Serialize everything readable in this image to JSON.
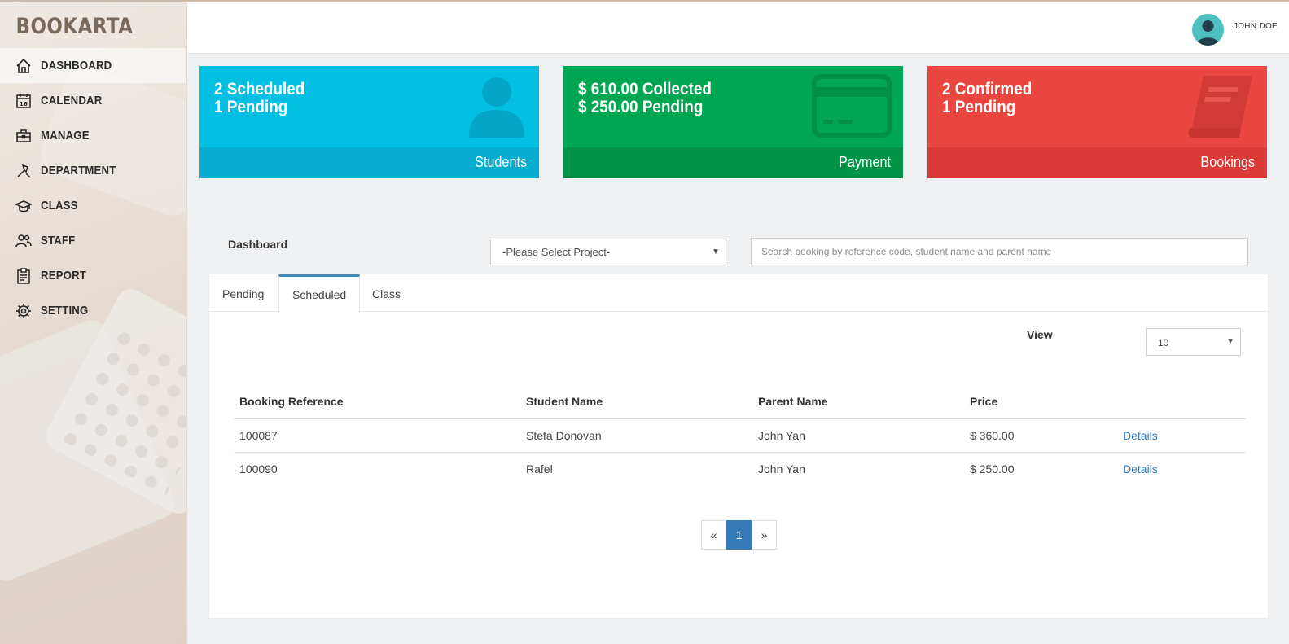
{
  "app": {
    "brand": "BOOKARTA"
  },
  "sidebar": {
    "items": [
      {
        "label": "DASHBOARD",
        "icon": "home-icon"
      },
      {
        "label": "CALENDAR",
        "icon": "calendar-icon",
        "badge": "16"
      },
      {
        "label": "MANAGE",
        "icon": "briefcase-icon"
      },
      {
        "label": "DEPARTMENT",
        "icon": "tools-icon"
      },
      {
        "label": "CLASS",
        "icon": "graduation-cap-icon"
      },
      {
        "label": "STAFF",
        "icon": "users-icon"
      },
      {
        "label": "REPORT",
        "icon": "clipboard-icon"
      },
      {
        "label": "SETTING",
        "icon": "gear-icon"
      }
    ]
  },
  "header": {
    "username": "JOHN DOE"
  },
  "cards": {
    "students": {
      "line1": "2 Scheduled",
      "line2": "1 Pending",
      "footer": "Students",
      "color": "#03c0e2",
      "icon": "user-icon"
    },
    "payment": {
      "line1": "$ 610.00 Collected",
      "line2": "$ 250.00 Pending",
      "footer": "Payment",
      "color": "#00a651",
      "icon": "credit-card-icon"
    },
    "bookings": {
      "line1": "2 Confirmed",
      "line2": "1 Pending",
      "footer": "Bookings",
      "color": "#ea4640",
      "icon": "book-icon"
    }
  },
  "filters": {
    "title": "Dashboard",
    "project_select": "-Please Select Project-",
    "search_placeholder": "Search booking by reference code, student name and parent name"
  },
  "tabs": [
    {
      "label": "Pending",
      "active": false
    },
    {
      "label": "Scheduled",
      "active": true
    },
    {
      "label": "Class",
      "active": false
    }
  ],
  "view": {
    "label": "View",
    "value": "10"
  },
  "table": {
    "headers": [
      "Booking Reference",
      "Student Name",
      "Parent Name",
      "Price",
      ""
    ],
    "rows": [
      {
        "ref": "100087",
        "student": "Stefa Donovan",
        "parent": "John Yan",
        "price": "$ 360.00",
        "action": "Details"
      },
      {
        "ref": "100090",
        "student": "Rafel",
        "parent": "John Yan",
        "price": "$ 250.00",
        "action": "Details"
      }
    ]
  },
  "pagination": {
    "prev": "«",
    "current": "1",
    "next": "»"
  }
}
